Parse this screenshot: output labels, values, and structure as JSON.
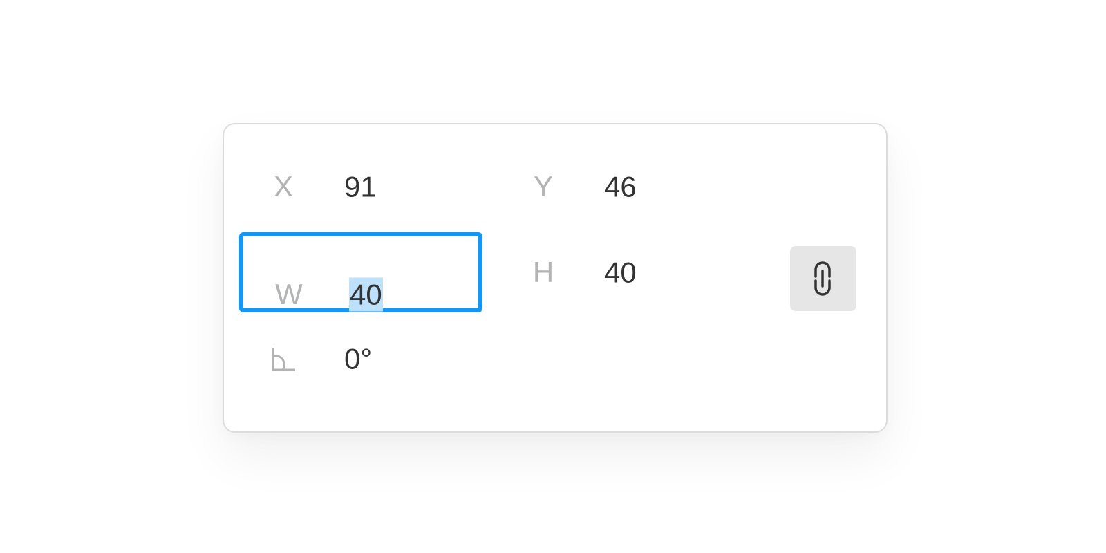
{
  "panel": {
    "x": {
      "label": "X",
      "value": "91"
    },
    "y": {
      "label": "Y",
      "value": "46"
    },
    "w": {
      "label": "W",
      "value": "40",
      "focused": true,
      "selected": true
    },
    "h": {
      "label": "H",
      "value": "40"
    },
    "rotation": {
      "icon": "angle-icon",
      "value": "0°"
    },
    "constrain_proportions": {
      "icon": "link-icon",
      "active": true
    }
  },
  "colors": {
    "focus_border": "#0d99ff",
    "selection": "#bde0fb",
    "label": "#b3b3b3",
    "value": "#333333",
    "button_bg": "#e6e6e6"
  }
}
